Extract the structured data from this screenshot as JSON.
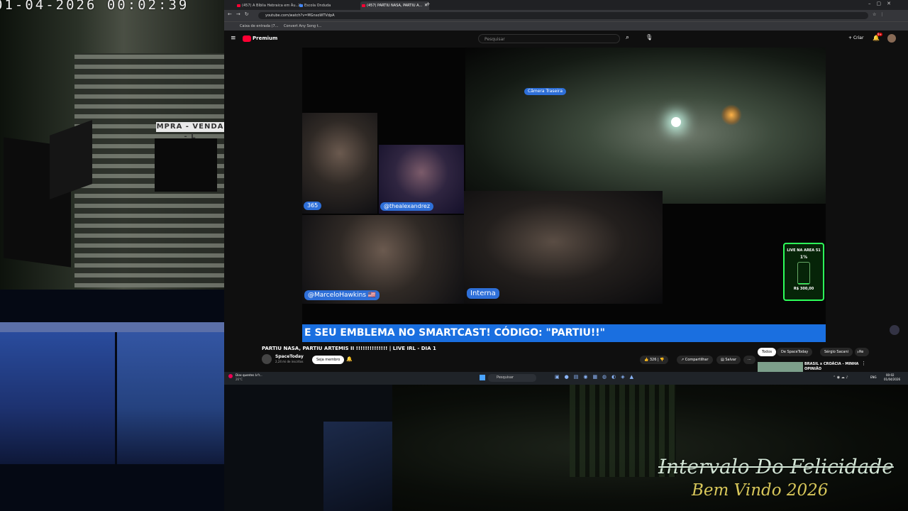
{
  "overlay": {
    "timestamp": "01-04-2026 00:02:39",
    "line1": "Intervalo Do Felicidade",
    "line2": "Bem Vindo 2026"
  },
  "cam_top": {
    "sign_text": "MPRA - VENDA - L"
  },
  "browser": {
    "tabs": [
      {
        "label": "(457) A Bíblia Hebraica em Áu...",
        "icon_color": "#ff0033",
        "active": false
      },
      {
        "label": "Escola Onduda",
        "icon_color": "#4285f4",
        "active": false
      },
      {
        "label": "(457) PARTIU NASA, PARTIU A...",
        "icon_color": "#ff0033",
        "active": true
      }
    ],
    "url": "youtube.com/watch?v=MGnsoWTVdpA",
    "bookmarks": [
      "Caixa de entrada (7...",
      "Convert Any Song t..."
    ]
  },
  "youtube": {
    "logo": "Premium",
    "search_placeholder": "Pesquisar",
    "create_label": "Criar",
    "notif_badge": "9+",
    "video": {
      "camera_label": "Câmera Traseira",
      "tag_365": "365",
      "tag_thealexandrez": "@thealexandrez",
      "tag_marcelo": "@MarceloHawkins 🇺🇸",
      "tag_interna": "Interna",
      "ticker": "E SEU EMBLEMA NO SMARTCAST! CÓDIGO: \"PARTIU!!\"",
      "gauge_title": "LIVE NA AREA 51",
      "gauge_value": "1%",
      "gauge_footer": "R$ 300,00",
      "gauge_level": 0.01
    },
    "title": "PARTIU NASA, PARTIU ARTEMIS II !!!!!!!!!!!!!! | LIVE IRL - DIA 1",
    "channel": "SpaceToday",
    "subs": "2,24 mi de inscritos",
    "join_label": "Seja membro",
    "likes": "326",
    "share_label": "Compartilhar",
    "save_label": "Salvar",
    "chips": [
      "Todos",
      "De SpaceToday",
      "Sérgio Sacani",
      "Re"
    ],
    "rec_title": "BRASIL x CROÁCIA - MINHA OPINIÃO"
  },
  "taskbar": {
    "weather": "Dias quentes à fr...",
    "temp": "26°C",
    "search": "Pesquisar",
    "lang": "ENG",
    "time": "00:02",
    "date": "01/04/2026"
  }
}
